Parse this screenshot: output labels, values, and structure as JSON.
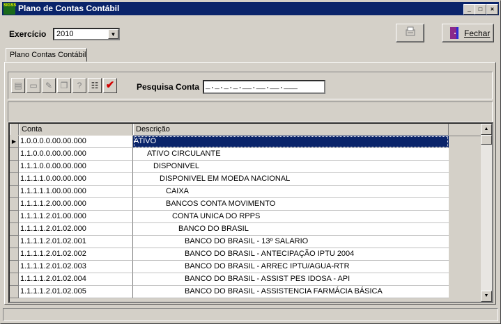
{
  "window": {
    "title": "Plano de Contas Contábil",
    "app_icon_text": "SIGSS",
    "min": "_",
    "max": "□",
    "close": "×"
  },
  "header": {
    "exercicio_label": "Exercício",
    "exercicio_value": "2010",
    "fechar_label": "Fechar"
  },
  "tabs": [
    {
      "label": "Plano Contas Contábil"
    }
  ],
  "search": {
    "label": "Pesquisa Conta",
    "value": "_._._._.__.__.__.___"
  },
  "grid": {
    "columns": [
      "Conta",
      "Descrição"
    ],
    "rows": [
      {
        "conta": "1.0.0.0.0.00.00.000",
        "descricao": "ATIVO",
        "level": 0,
        "selected": true
      },
      {
        "conta": "1.1.0.0.0.00.00.000",
        "descricao": "ATIVO CIRCULANTE",
        "level": 1
      },
      {
        "conta": "1.1.1.0.0.00.00.000",
        "descricao": "DISPONIVEL",
        "level": 2
      },
      {
        "conta": "1.1.1.1.0.00.00.000",
        "descricao": "DISPONIVEL EM MOEDA NACIONAL",
        "level": 3
      },
      {
        "conta": "1.1.1.1.1.00.00.000",
        "descricao": "CAIXA",
        "level": 4
      },
      {
        "conta": "1.1.1.1.2.00.00.000",
        "descricao": "BANCOS CONTA MOVIMENTO",
        "level": 4
      },
      {
        "conta": "1.1.1.1.2.01.00.000",
        "descricao": "CONTA UNICA DO RPPS",
        "level": 5
      },
      {
        "conta": "1.1.1.1.2.01.02.000",
        "descricao": "BANCO DO BRASIL",
        "level": 6
      },
      {
        "conta": "1.1.1.1.2.01.02.001",
        "descricao": "BANCO DO BRASIL - 13º SALARIO",
        "level": 7
      },
      {
        "conta": "1.1.1.1.2.01.02.002",
        "descricao": "BANCO DO BRASIL - ANTECIPAÇÃO IPTU 2004",
        "level": 7
      },
      {
        "conta": "1.1.1.1.2.01.02.003",
        "descricao": "BANCO DO BRASIL - ARREC IPTU/AGUA-RTR",
        "level": 7
      },
      {
        "conta": "1.1.1.1.2.01.02.004",
        "descricao": "BANCO DO BRASIL - ASSIST PES IDOSA - API",
        "level": 7
      },
      {
        "conta": "1.1.1.1.2.01.02.005",
        "descricao": "BANCO DO BRASIL - ASSISTENCIA FARMÁCIA BÁSICA",
        "level": 7
      }
    ]
  },
  "colors": {
    "title_bg": "#0a246a",
    "face": "#d4d0c8",
    "selected": "#0a246a",
    "check": "#d40000"
  }
}
